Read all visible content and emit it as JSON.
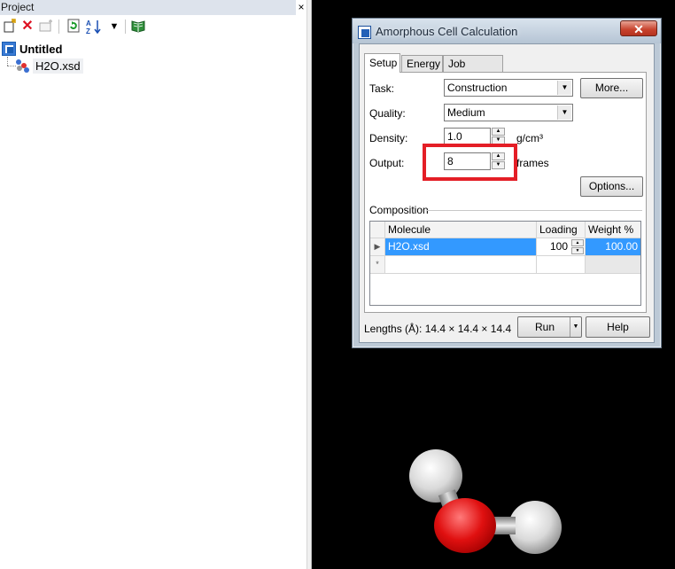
{
  "project_panel": {
    "title": "Project",
    "close_glyph": "×",
    "toolbar": {
      "icons": [
        "new-document-icon",
        "delete-icon",
        "new-folder-icon",
        "refresh-icon",
        "sort-az-icon",
        "dropdown-arrow-icon",
        "open-book-icon"
      ]
    },
    "tree": {
      "root_label": "Untitled",
      "child_label": "H2O.xsd"
    }
  },
  "dialog": {
    "title": "Amorphous Cell Calculation",
    "close_glyph": "✕",
    "tabs": [
      {
        "label": "Setup",
        "active": true
      },
      {
        "label": "Energy",
        "active": false
      },
      {
        "label": "Job Control",
        "active": false
      }
    ],
    "setup": {
      "task_label": "Task:",
      "task_value": "Construction",
      "more_button": "More...",
      "quality_label": "Quality:",
      "quality_value": "Medium",
      "density_label": "Density:",
      "density_value": "1.0",
      "density_unit": "g/cm³",
      "output_label": "Output:",
      "output_value": "8",
      "output_unit": "frames",
      "options_button": "Options...",
      "composition_label": "Composition",
      "grid": {
        "columns": [
          "Molecule",
          "Loading",
          "Weight %"
        ],
        "rows": [
          {
            "molecule": "H2O.xsd",
            "loading": "100",
            "weight": "100.00"
          }
        ],
        "new_row_marker": "*"
      }
    },
    "footer": {
      "lengths_text": "Lengths (Å): 14.4 × 14.4 × 14.4",
      "run_button": "Run",
      "help_button": "Help"
    }
  },
  "colors": {
    "highlight": "#e41e26",
    "selection": "#3399ff",
    "oxygen": "#e01010",
    "hydrogen": "#e8e8e8",
    "viewer_bg": "#000000"
  }
}
